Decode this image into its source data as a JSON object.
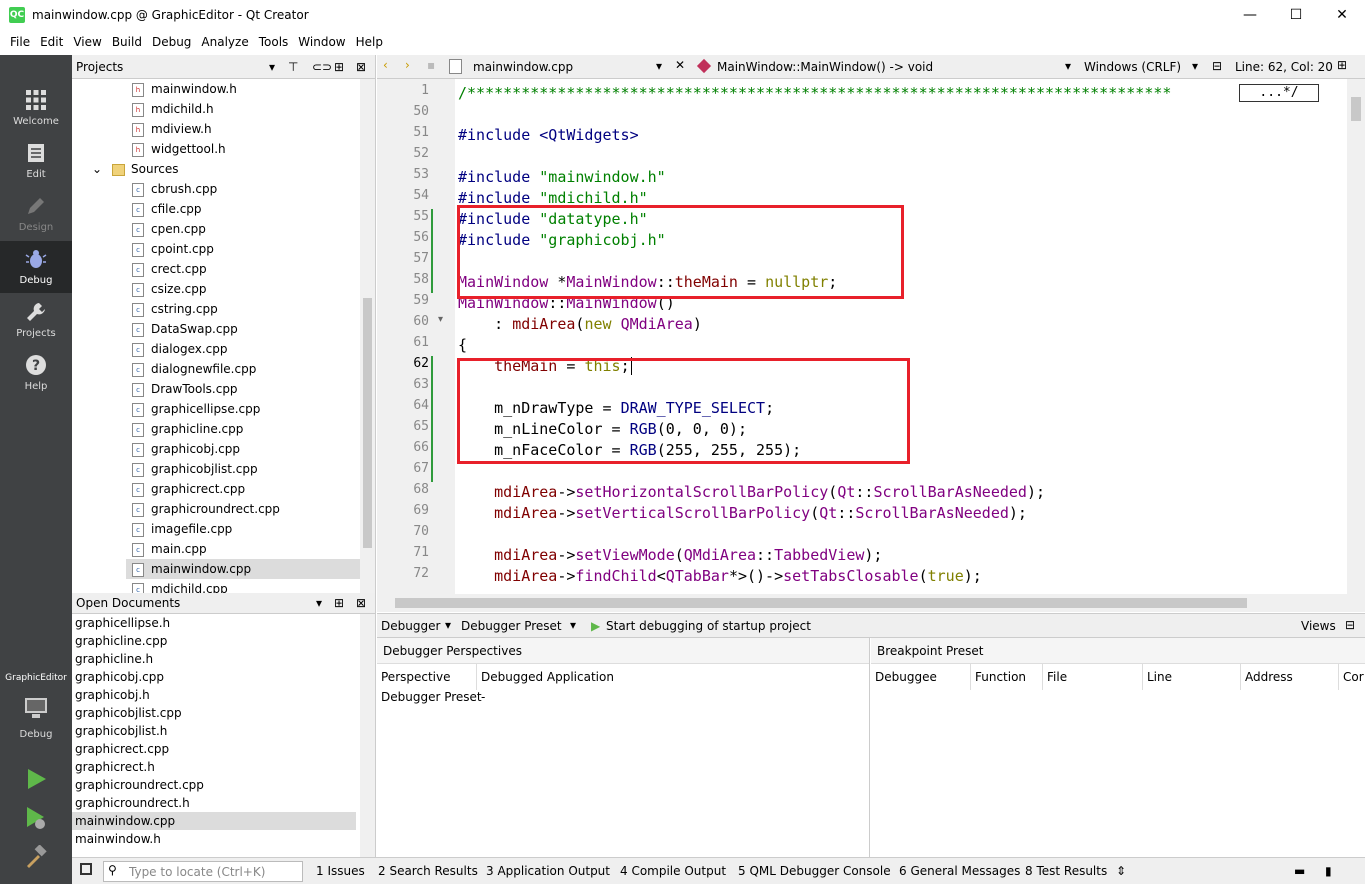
{
  "window": {
    "title": "mainwindow.cpp @ GraphicEditor - Qt Creator",
    "app_icon": "QC",
    "minimize": "—",
    "maximize": "☐",
    "close": "✕"
  },
  "menu": [
    "File",
    "Edit",
    "View",
    "Build",
    "Debug",
    "Analyze",
    "Tools",
    "Window",
    "Help"
  ],
  "modes": {
    "welcome": "Welcome",
    "edit": "Edit",
    "design": "Design",
    "debug": "Debug",
    "projects": "Projects",
    "help": "Help"
  },
  "kit": {
    "project": "GraphicEditor",
    "config": "Debug"
  },
  "projects": {
    "header": "Projects",
    "headers": [
      "mainwindow.h",
      "mdichild.h",
      "mdiview.h",
      "widgettool.h"
    ],
    "sources_label": "Sources",
    "sources": [
      "cbrush.cpp",
      "cfile.cpp",
      "cpen.cpp",
      "cpoint.cpp",
      "crect.cpp",
      "csize.cpp",
      "cstring.cpp",
      "DataSwap.cpp",
      "dialogex.cpp",
      "dialognewfile.cpp",
      "DrawTools.cpp",
      "graphicellipse.cpp",
      "graphicline.cpp",
      "graphicobj.cpp",
      "graphicobjlist.cpp",
      "graphicrect.cpp",
      "graphicroundrect.cpp",
      "imagefile.cpp",
      "main.cpp",
      "mainwindow.cpp",
      "mdichild.cpp"
    ],
    "selected": "mainwindow.cpp"
  },
  "open_documents": {
    "header": "Open Documents",
    "items": [
      "graphicellipse.h",
      "graphicline.cpp",
      "graphicline.h",
      "graphicobj.cpp",
      "graphicobj.h",
      "graphicobjlist.cpp",
      "graphicobjlist.h",
      "graphicrect.cpp",
      "graphicrect.h",
      "graphicroundrect.cpp",
      "graphicroundrect.h",
      "mainwindow.cpp",
      "mainwindow.h"
    ],
    "selected": "mainwindow.cpp"
  },
  "editor": {
    "file": "mainwindow.cpp",
    "symbol": "MainWindow::MainWindow() -> void",
    "line_ending": "Windows (CRLF)",
    "position": "Line: 62, Col: 20",
    "fold_marker": "...*/"
  },
  "code_lines": [
    {
      "n": "1",
      "t": "/******************************************************************************"
    },
    {
      "n": "50",
      "t": ""
    },
    {
      "n": "51",
      "t": "#include <QtWidgets>"
    },
    {
      "n": "52",
      "t": ""
    },
    {
      "n": "53",
      "t": "#include \"mainwindow.h\""
    },
    {
      "n": "54",
      "t": "#include \"mdichild.h\""
    },
    {
      "n": "55",
      "t": "#include \"datatype.h\""
    },
    {
      "n": "56",
      "t": "#include \"graphicobj.h\""
    },
    {
      "n": "57",
      "t": ""
    },
    {
      "n": "58",
      "t": "MainWindow *MainWindow::theMain = nullptr;"
    },
    {
      "n": "59",
      "t": "MainWindow::MainWindow()"
    },
    {
      "n": "60",
      "t": "    : mdiArea(new QMdiArea)"
    },
    {
      "n": "61",
      "t": "{"
    },
    {
      "n": "62",
      "t": "    theMain = this;"
    },
    {
      "n": "63",
      "t": ""
    },
    {
      "n": "64",
      "t": "    m_nDrawType = DRAW_TYPE_SELECT;"
    },
    {
      "n": "65",
      "t": "    m_nLineColor = RGB(0, 0, 0);"
    },
    {
      "n": "66",
      "t": "    m_nFaceColor = RGB(255, 255, 255);"
    },
    {
      "n": "67",
      "t": ""
    },
    {
      "n": "68",
      "t": "    mdiArea->setHorizontalScrollBarPolicy(Qt::ScrollBarAsNeeded);"
    },
    {
      "n": "69",
      "t": "    mdiArea->setVerticalScrollBarPolicy(Qt::ScrollBarAsNeeded);"
    },
    {
      "n": "70",
      "t": ""
    },
    {
      "n": "71",
      "t": "    mdiArea->setViewMode(QMdiArea::TabbedView);"
    },
    {
      "n": "72",
      "t": "    mdiArea->findChild<QTabBar*>()->setTabsClosable(true);"
    }
  ],
  "debugger": {
    "debugger_label": "Debugger",
    "preset_label": "Debugger Preset",
    "start_label": "Start debugging of startup project",
    "views_label": "Views",
    "perspectives_title": "Debugger Perspectives",
    "perspective_cols": [
      "Perspective",
      "Debugged Application"
    ],
    "perspective_row": [
      "Debugger Preset",
      "-"
    ],
    "breakpoint_title": "Breakpoint Preset",
    "breakpoint_cols": [
      "Debuggee",
      "Function",
      "File",
      "Line",
      "Address",
      "Cor"
    ]
  },
  "status": {
    "locator_placeholder": "Type to locate (Ctrl+K)",
    "tabs": [
      "1  Issues",
      "2  Search Results",
      "3  Application Output",
      "4  Compile Output",
      "5  QML Debugger Console",
      "6  General Messages",
      "8  Test Results"
    ]
  },
  "colors": {
    "accent_red": "#e8202a",
    "mode_bar": "#404244",
    "qt_green": "#41cd52"
  }
}
